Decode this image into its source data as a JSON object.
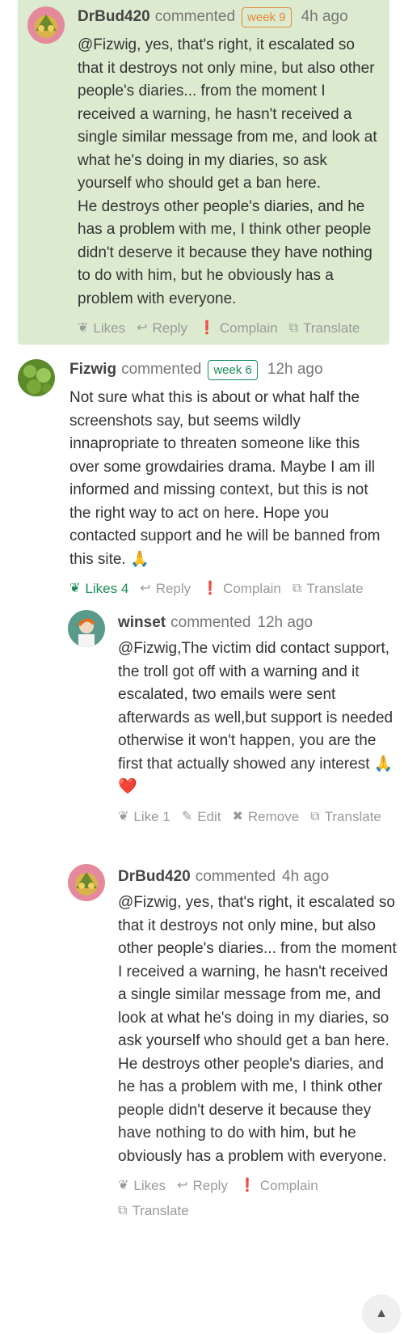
{
  "comments": [
    {
      "author": "DrBud420",
      "verb": "commented",
      "week": "week 9",
      "time": "4h ago",
      "text": "@Fizwig, yes, that's right, it escalated so that it destroys not only mine, but also other people's diaries... from the moment I received a warning, he hasn't received a single similar message from me, and look at what he's doing in my diaries, so ask yourself who should get a ban here.\nHe destroys other people's diaries, and he has a problem with me, I think other people didn't deserve it because they have nothing to do with him, but he obviously has a problem with everyone.",
      "actions": {
        "likes": "Likes",
        "reply": "Reply",
        "complain": "Complain",
        "translate": "Translate"
      }
    },
    {
      "author": "Fizwig",
      "verb": "commented",
      "week": "week 6",
      "time": "12h ago",
      "text": "Not sure what this is about or what half the screenshots say, but seems wildly innapropriate to threaten someone like this over some growdairies drama. Maybe I am ill informed and missing context, but this is not the right way to act on here. Hope you contacted support and he will be banned from this site. 🙏",
      "actions": {
        "likes": "Likes 4",
        "reply": "Reply",
        "complain": "Complain",
        "translate": "Translate"
      }
    },
    {
      "author": "winset",
      "verb": "commented",
      "time": "12h ago",
      "text": "@Fizwig,The victim did contact support, the troll got off with a warning and it escalated, two emails were sent afterwards as well,but support is needed otherwise it won't happen, you are the first that actually showed any interest 🙏❤️",
      "actions": {
        "like": "Like 1",
        "edit": "Edit",
        "remove": "Remove",
        "translate": "Translate"
      }
    },
    {
      "author": "DrBud420",
      "verb": "commented",
      "time": "4h ago",
      "text": "@Fizwig, yes, that's right, it escalated so that it destroys not only mine, but also other people's diaries... from the moment I received a warning, he hasn't received a single similar message from me, and look at what he's doing in my diaries, so ask yourself who should get a ban here.\nHe destroys other people's diaries, and he has a problem with me, I think other people didn't deserve it because they have nothing to do with him, but he obviously has a problem with everyone.",
      "actions": {
        "likes": "Likes",
        "reply": "Reply",
        "complain": "Complain",
        "translate": "Translate"
      }
    }
  ],
  "colors": {
    "highlight_bg": "#dcebd0",
    "accent_green": "#1a8a5c",
    "week_orange": "#e8873a"
  },
  "scroll_top_icon": "chevron-up-icon"
}
